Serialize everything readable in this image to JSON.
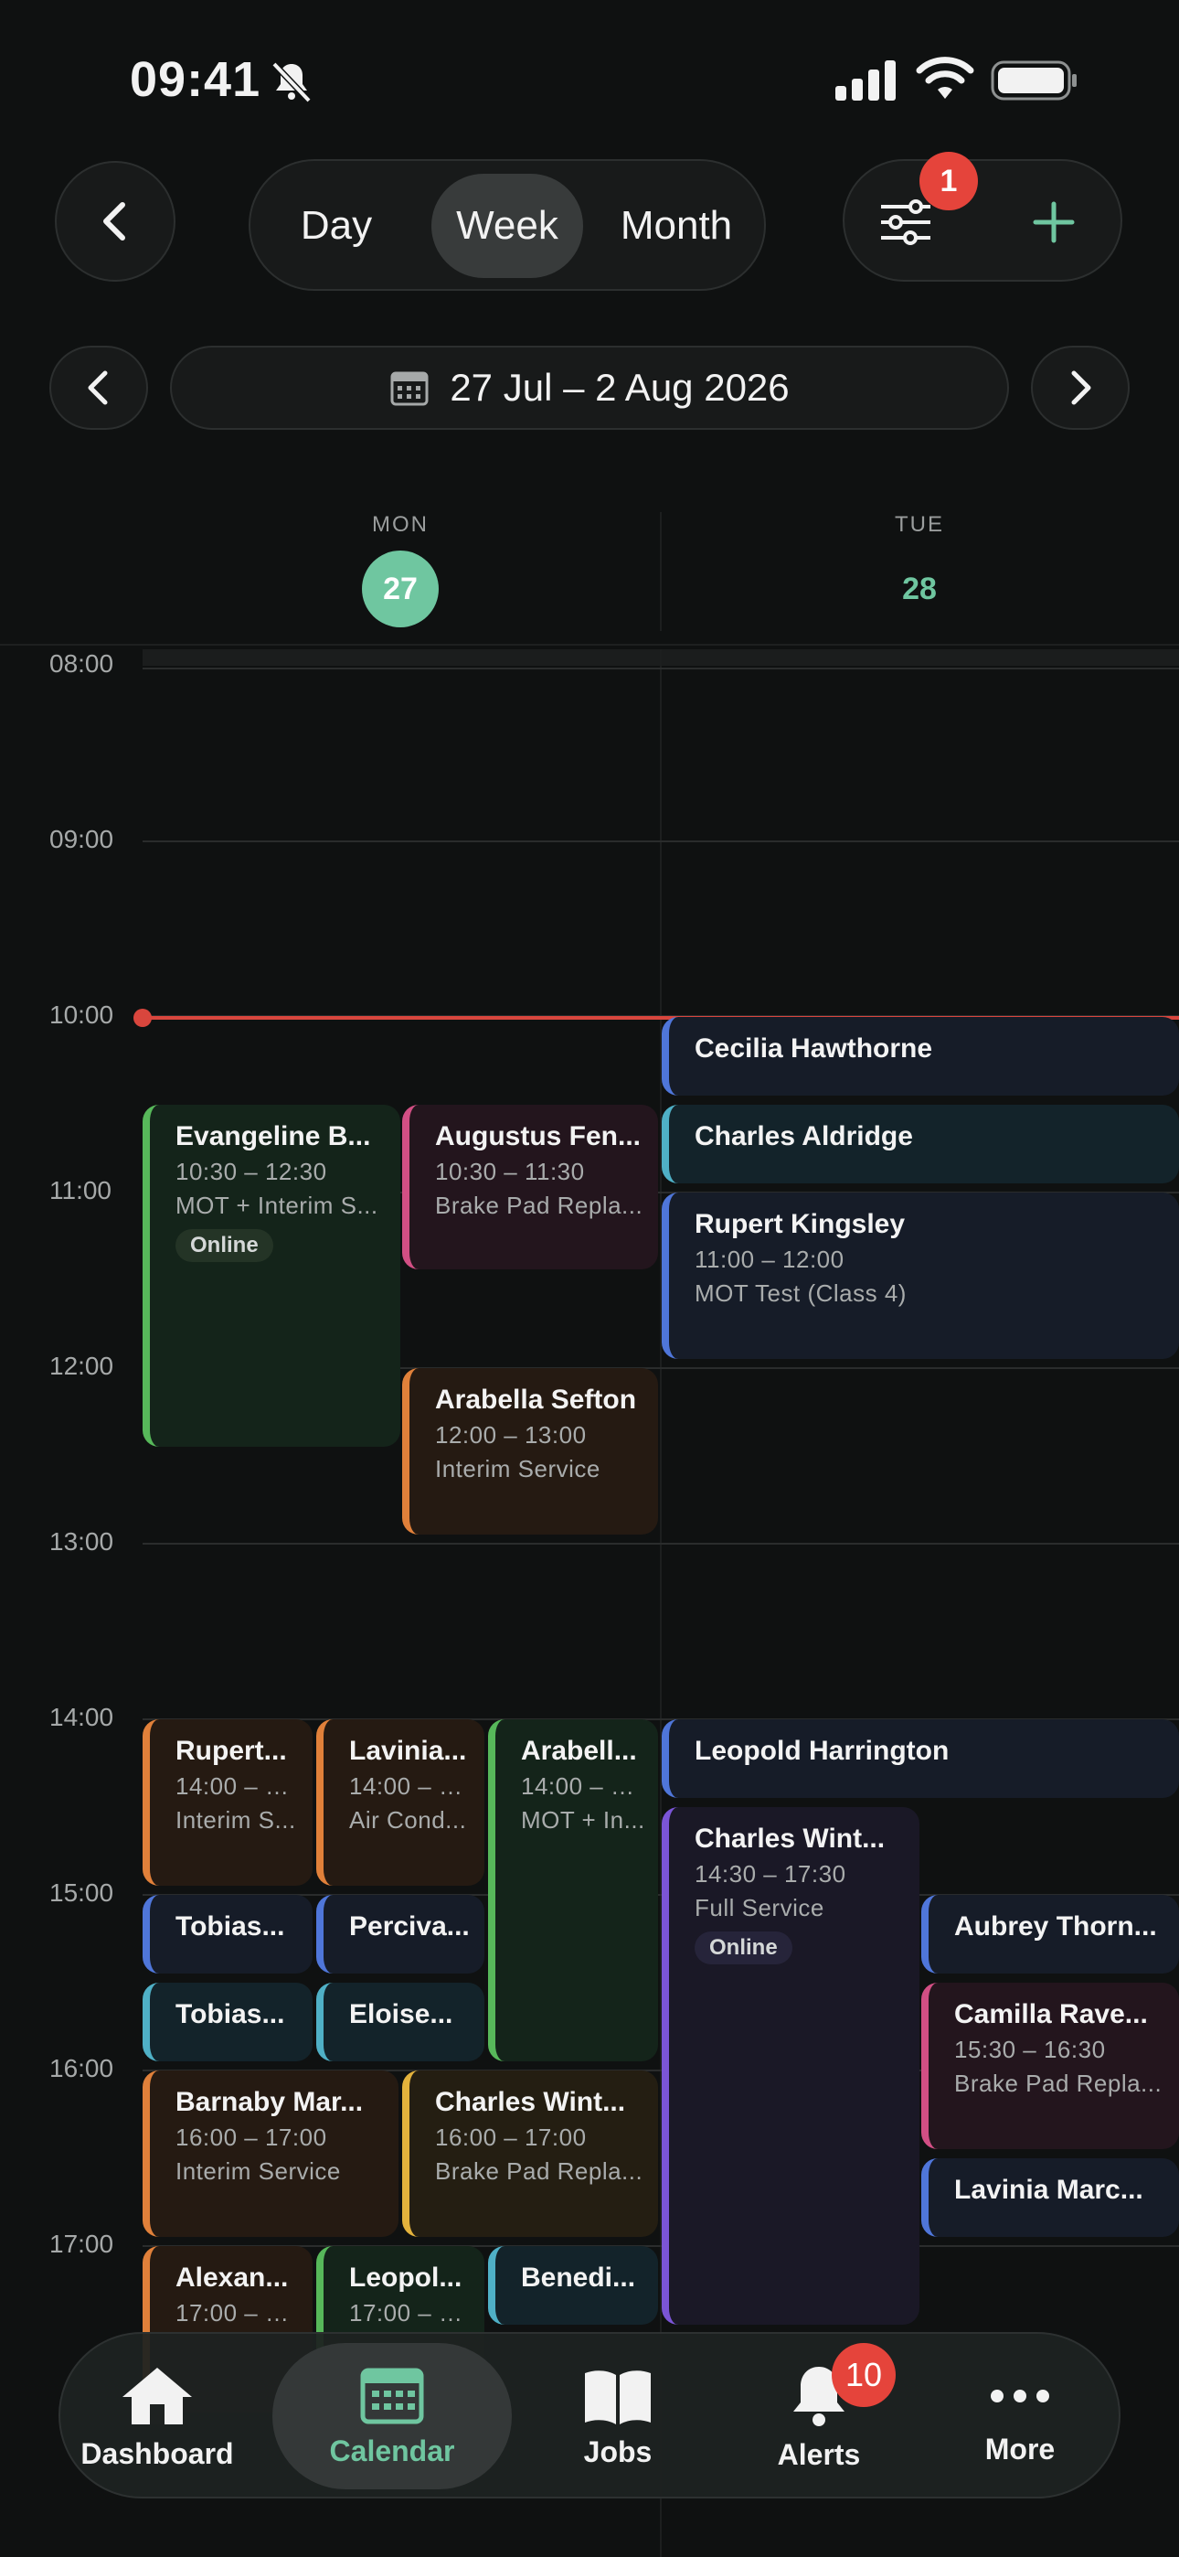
{
  "status": {
    "time": "09:41"
  },
  "view_switcher": {
    "options": [
      "Day",
      "Week",
      "Month"
    ],
    "selected": "Week"
  },
  "filter": {
    "badge": "1"
  },
  "date_range": "27 Jul – 2 Aug 2026",
  "days": [
    {
      "dow": "MON",
      "num": "27",
      "today": true
    },
    {
      "dow": "TUE",
      "num": "28",
      "today": false
    }
  ],
  "hours": [
    "08:00",
    "09:00",
    "10:00",
    "11:00",
    "12:00",
    "13:00",
    "14:00",
    "15:00",
    "16:00",
    "17:00"
  ],
  "colors": {
    "accent": "#6fc6a0",
    "now_line": "#d9463d",
    "badge": "#e5443b"
  },
  "events": [
    {
      "title": "Evangeline B...",
      "time": "10:30 – 12:30",
      "service": "MOT + Interim S...",
      "tag": "Online",
      "color": "#57b85a"
    },
    {
      "title": "Augustus Fen...",
      "time": "10:30 – 11:30",
      "service": "Brake Pad Repla...",
      "color": "#d24f84"
    },
    {
      "title": "Arabella Sefton",
      "time": "12:00 – 13:00",
      "service": "Interim Service",
      "color": "#e0803a"
    },
    {
      "title": "Cecilia Hawthorne",
      "color": "#4f76d9"
    },
    {
      "title": "Charles Aldridge",
      "color": "#4fb0c6"
    },
    {
      "title": "Rupert Kingsley",
      "time": "11:00 – 12:00",
      "service": "MOT Test (Class 4)",
      "color": "#4f76d9"
    },
    {
      "title": "Rupert...",
      "time": "14:00 – 1...",
      "service": "Interim S...",
      "color": "#e0803a"
    },
    {
      "title": "Lavinia...",
      "time": "14:00 – 1...",
      "service": "Air Cond...",
      "color": "#e0803a"
    },
    {
      "title": "Arabell...",
      "time": "14:00 – 1...",
      "service": "MOT + In...",
      "color": "#57b85a"
    },
    {
      "title": "Leopold Harrington",
      "color": "#4f76d9"
    },
    {
      "title": "Charles Wint...",
      "time": "14:30 – 17:30",
      "service": "Full Service",
      "tag": "Online",
      "color": "#7b55d6"
    },
    {
      "title": "Tobias...",
      "color": "#4f76d9"
    },
    {
      "title": "Perciva...",
      "color": "#4f76d9"
    },
    {
      "title": "Aubrey Thorn...",
      "color": "#4f76d9"
    },
    {
      "title": "Tobias...",
      "color": "#4fb0c6"
    },
    {
      "title": "Eloise...",
      "color": "#4fb0c6"
    },
    {
      "title": "Camilla Rave...",
      "time": "15:30 – 16:30",
      "service": "Brake Pad Repla...",
      "color": "#d24f84"
    },
    {
      "title": "Barnaby Mar...",
      "time": "16:00 – 17:00",
      "service": "Interim Service",
      "color": "#e0803a"
    },
    {
      "title": "Charles Wint...",
      "time": "16:00 – 17:00",
      "service": "Brake Pad Repla...",
      "color": "#e3b23c"
    },
    {
      "title": "Lavinia Marc...",
      "color": "#4f76d9"
    },
    {
      "title": "Alexan...",
      "time": "17:00 – 1...",
      "color": "#e0803a"
    },
    {
      "title": "Leopol...",
      "time": "17:00 – 1...",
      "color": "#57b85a"
    },
    {
      "title": "Benedi...",
      "color": "#4fb0c6"
    }
  ],
  "tabs": [
    {
      "label": "Dashboard",
      "icon": "house-icon"
    },
    {
      "label": "Calendar",
      "icon": "calendar-icon",
      "active": true
    },
    {
      "label": "Jobs",
      "icon": "book-icon"
    },
    {
      "label": "Alerts",
      "icon": "bell-icon",
      "badge": "10"
    },
    {
      "label": "More",
      "icon": "more-icon"
    }
  ]
}
